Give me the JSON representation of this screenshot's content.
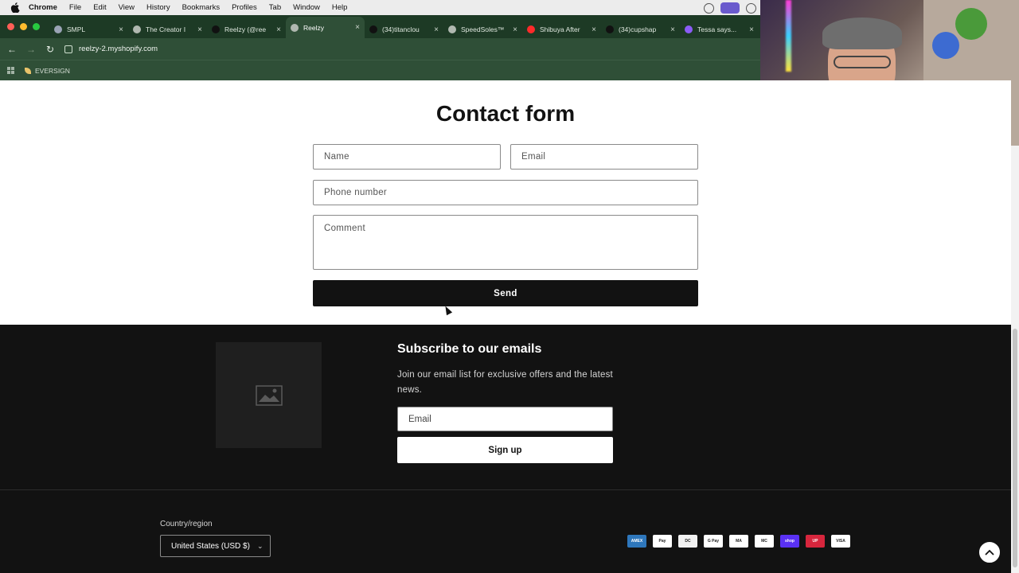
{
  "menubar": {
    "app": "Chrome",
    "items": [
      "File",
      "Edit",
      "View",
      "History",
      "Bookmarks",
      "Profiles",
      "Tab",
      "Window",
      "Help"
    ]
  },
  "browser": {
    "tabs": [
      {
        "label": "SMPL",
        "favicon_color": "#9aa3b5"
      },
      {
        "label": "The Creator I",
        "favicon_color": "#b0b8b0"
      },
      {
        "label": "Reelzy (@ree",
        "favicon_color": "#111111"
      },
      {
        "label": "Reelzy",
        "favicon_color": "#b0b8b0"
      },
      {
        "label": "(34)titanclou",
        "favicon_color": "#111111"
      },
      {
        "label": "SpeedSoles™",
        "favicon_color": "#b0b8b0"
      },
      {
        "label": "Shibuya After",
        "favicon_color": "#ff2a2a"
      },
      {
        "label": "(34)cupshap",
        "favicon_color": "#111111"
      },
      {
        "label": "Tessa says...",
        "favicon_color": "#8b5cf6"
      }
    ],
    "active_tab_index": 3,
    "url": "reelzy-2.myshopify.com",
    "bookmarks": [
      "EVERSIGN"
    ]
  },
  "contact": {
    "title": "Contact form",
    "name_placeholder": "Name",
    "email_placeholder": "Email",
    "phone_placeholder": "Phone number",
    "comment_placeholder": "Comment",
    "send_label": "Send"
  },
  "footer": {
    "subscribe_title": "Subscribe to our emails",
    "subscribe_desc": "Join our email list for exclusive offers and the latest news.",
    "email_placeholder": "Email",
    "signup_label": "Sign up",
    "country_label": "Country/region",
    "country_value": "United States (USD $)",
    "payment_methods": [
      {
        "name": "American Express",
        "short": "AMEX",
        "color": "#2e77bc"
      },
      {
        "name": "Apple Pay",
        "short": "Pay",
        "color": "#ffffff"
      },
      {
        "name": "Diners Club",
        "short": "DC",
        "color": "#f2f2f2"
      },
      {
        "name": "Google Pay",
        "short": "G Pay",
        "color": "#ffffff"
      },
      {
        "name": "Maestro",
        "short": "MA",
        "color": "#ffffff"
      },
      {
        "name": "Mastercard",
        "short": "MC",
        "color": "#ffffff"
      },
      {
        "name": "Shop Pay",
        "short": "shop",
        "color": "#5a31f4"
      },
      {
        "name": "UnionPay",
        "short": "UP",
        "color": "#d7263d"
      },
      {
        "name": "Visa",
        "short": "VISA",
        "color": "#ffffff"
      }
    ]
  },
  "colors": {
    "browser_dark": "#1d3a25",
    "browser_toolbar": "#2f4f37",
    "footer_bg": "#121212",
    "button_dark": "#121212"
  }
}
